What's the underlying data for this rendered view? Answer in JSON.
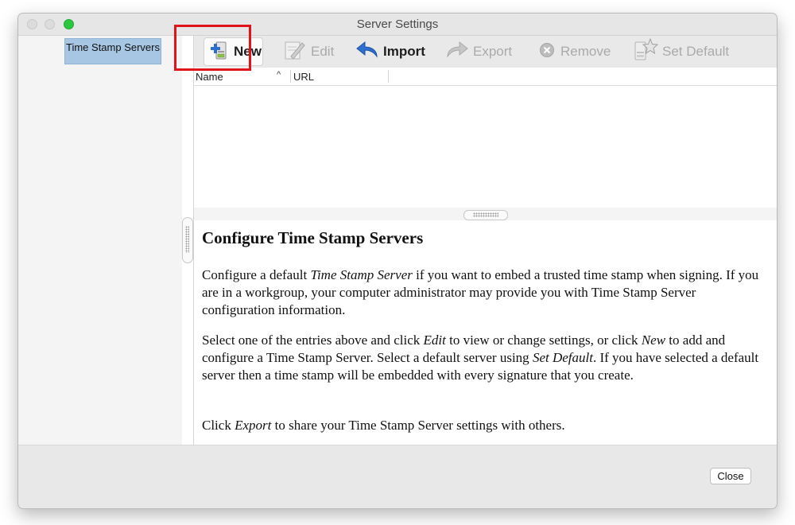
{
  "window": {
    "title": "Server Settings"
  },
  "sidebar": {
    "items": [
      {
        "label": "Time Stamp Servers",
        "selected": true
      }
    ]
  },
  "toolbar": {
    "buttons": [
      {
        "label": "New",
        "icon": "new-server-icon",
        "enabled": true,
        "highlighted": true
      },
      {
        "label": "Edit",
        "icon": "edit-pencil-icon",
        "enabled": false
      },
      {
        "label": "Import",
        "icon": "import-arrow-icon",
        "enabled": true
      },
      {
        "label": "Export",
        "icon": "export-arrow-icon",
        "enabled": false
      },
      {
        "label": "Remove",
        "icon": "remove-x-icon",
        "enabled": false
      },
      {
        "label": "Set Default",
        "icon": "set-default-star-icon",
        "enabled": false
      }
    ]
  },
  "table": {
    "columns": [
      {
        "label": "Name",
        "sort": "ascending"
      },
      {
        "label": "URL"
      }
    ],
    "rows": []
  },
  "help": {
    "heading": "Configure Time Stamp Servers",
    "p1": {
      "a": "Configure a default ",
      "b": "Time Stamp Server",
      "c": " if you want to embed a trusted time stamp when signing. If you are in a workgroup, your computer administrator may provide you with Time Stamp Server configuration information."
    },
    "p2": {
      "a": "Select one of the entries above and click ",
      "b": "Edit",
      "c": " to view or change settings, or click ",
      "d": "New",
      "e": " to add and configure a Time Stamp Server. Select a default server using ",
      "f": "Set Default",
      "g": ". If you have selected a default server then a time stamp will be embedded with every signature that you create."
    },
    "p3": {
      "a": "Click ",
      "b": "Export",
      "c": " to share your Time Stamp Server settings with others."
    }
  },
  "footer": {
    "close_label": "Close"
  },
  "colors": {
    "highlight": "#e0141b",
    "selection": "#a6c6e4",
    "zoom_button": "#2ac840"
  }
}
